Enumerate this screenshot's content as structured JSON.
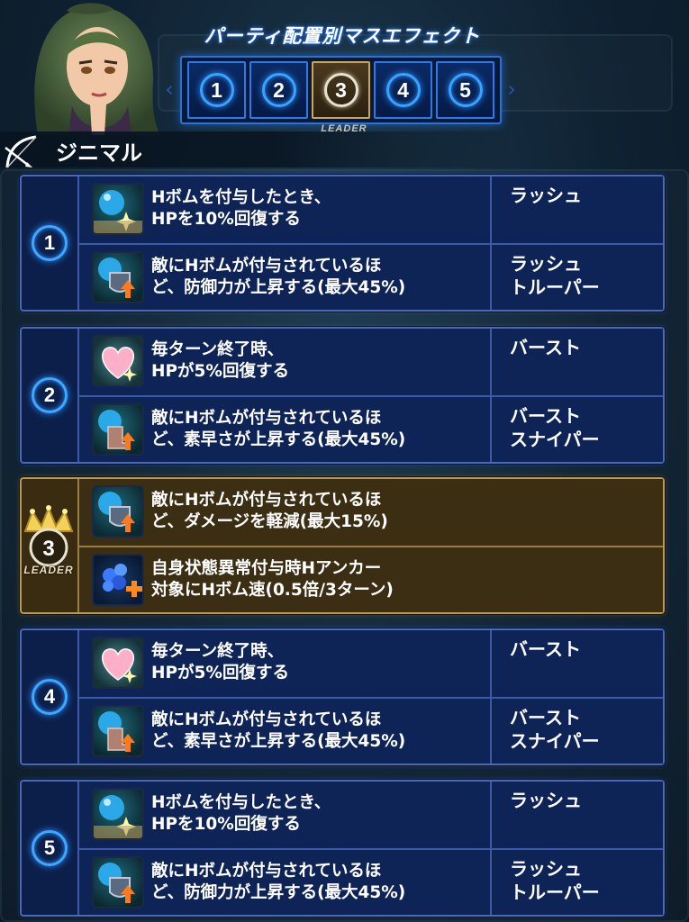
{
  "header": {
    "title": "パーティ配置別マスエフェクト",
    "leader_label": "LEADER"
  },
  "slots": [
    {
      "number": "1",
      "active": false
    },
    {
      "number": "2",
      "active": false
    },
    {
      "number": "3",
      "active": true
    },
    {
      "number": "4",
      "active": false
    },
    {
      "number": "5",
      "active": false
    }
  ],
  "character": {
    "name": "ジニマル",
    "weapon_icon": "bow-icon"
  },
  "groups": [
    {
      "position": "1",
      "effects": [
        {
          "icon": "hp-recover-icon",
          "text": "Hボムを付与したとき、\nHPを10%回復する",
          "condition": "ラッシュ"
        },
        {
          "icon": "defense-up-icon",
          "text": "敵にHボムが付与されているほ\nど、防御力が上昇する(最大45%)",
          "condition": "ラッシュ\nトルーパー"
        }
      ]
    },
    {
      "position": "2",
      "effects": [
        {
          "icon": "heart-regen-icon",
          "text": "毎ターン終了時、\nHPが5%回復する",
          "condition": "バースト"
        },
        {
          "icon": "speed-up-icon",
          "text": "敵にHボムが付与されているほ\nど、素早さが上昇する(最大45%)",
          "condition": "バースト\nスナイパー"
        }
      ]
    },
    {
      "position": "3",
      "leader": true,
      "effects": [
        {
          "icon": "damage-reduce-icon",
          "text": "敵にHボムが付与されているほ\nど、ダメージを軽減(最大15%)",
          "condition": ""
        },
        {
          "icon": "anchor-plus-icon",
          "text": "自身状態異常付与時Hアンカー\n対象にHボム速(0.5倍/3ターン)",
          "condition": ""
        }
      ]
    },
    {
      "position": "4",
      "effects": [
        {
          "icon": "heart-regen-icon",
          "text": "毎ターン終了時、\nHPが5%回復する",
          "condition": "バースト"
        },
        {
          "icon": "speed-up-icon",
          "text": "敵にHボムが付与されているほ\nど、素早さが上昇する(最大45%)",
          "condition": "バースト\nスナイパー"
        }
      ]
    },
    {
      "position": "5",
      "effects": [
        {
          "icon": "hp-recover-icon",
          "text": "Hボムを付与したとき、\nHPを10%回復する",
          "condition": "ラッシュ"
        },
        {
          "icon": "defense-up-icon",
          "text": "敵にHボムが付与されているほ\nど、防御力が上昇する(最大45%)",
          "condition": "ラッシュ\nトルーパー"
        }
      ]
    }
  ],
  "colors": {
    "panel_blue": "#0e2456",
    "panel_border": "#4a6ab8",
    "leader_gold": "#b8995a",
    "ring_blue": "#3ea8ff"
  }
}
